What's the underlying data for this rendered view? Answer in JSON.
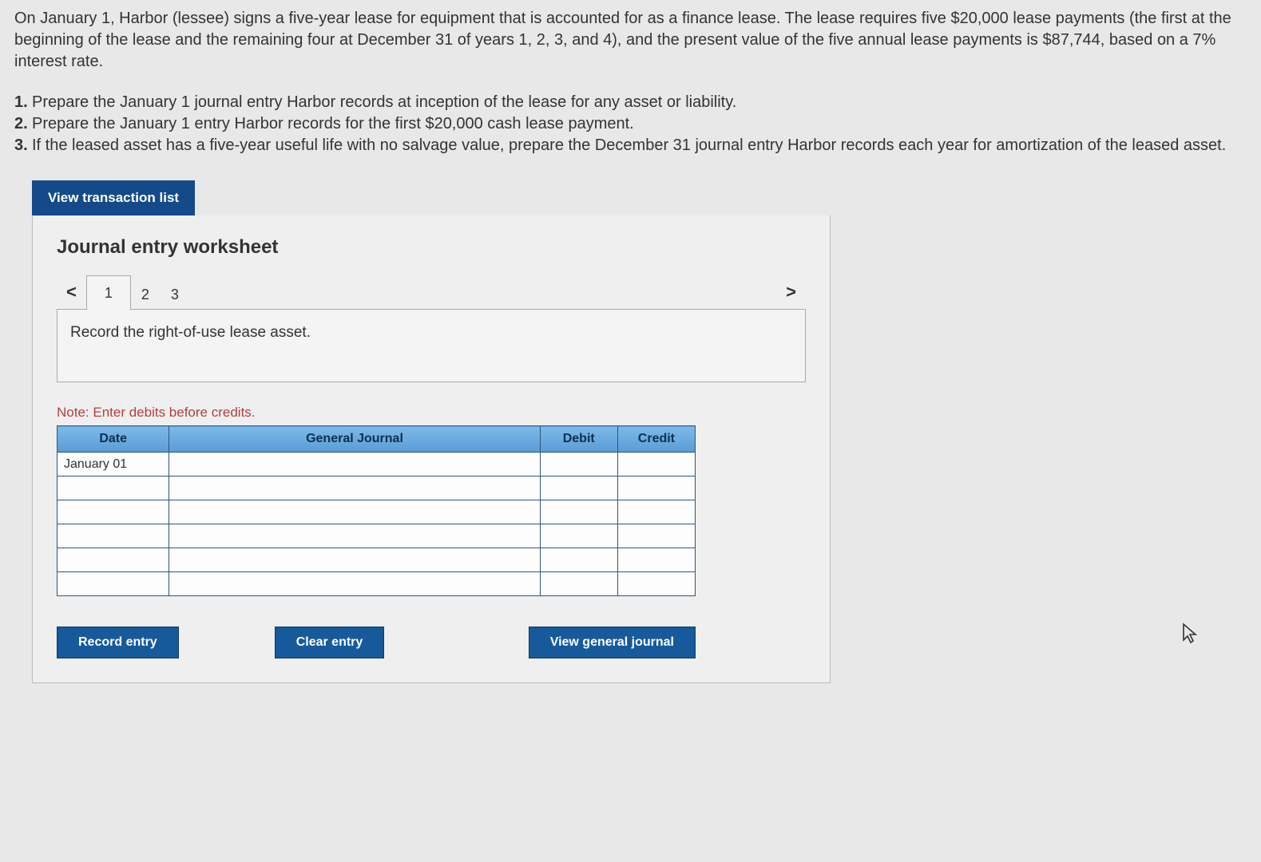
{
  "problem": {
    "p1": "On January 1, Harbor (lessee) signs a five-year lease for equipment that is accounted for as a finance lease. The lease requires five $20,000 lease payments (the first at the beginning of the lease and the remaining four at December 31 of years 1, 2, 3, and 4), and the present value of the five annual lease payments is $87,744, based on a 7% interest rate."
  },
  "questions": {
    "q1num": "1.",
    "q1": "Prepare the January 1 journal entry Harbor records at inception of the lease for any asset or liability.",
    "q2num": "2.",
    "q2": "Prepare the January 1 entry Harbor records for the first $20,000 cash lease payment.",
    "q3num": "3.",
    "q3": "If the leased asset has a five-year useful life with no salvage value, prepare the December 31 journal entry Harbor records each year for amortization of the leased asset."
  },
  "buttons": {
    "view_transaction": "View transaction list",
    "record_entry": "Record entry",
    "clear_entry": "Clear entry",
    "view_general_journal": "View general journal"
  },
  "worksheet": {
    "title": "Journal entry worksheet",
    "prev": "<",
    "next": ">",
    "tabs": [
      "1",
      "2",
      "3"
    ],
    "desc": "Record the right-of-use lease asset.",
    "note": "Note: Enter debits before credits.",
    "headers": {
      "date": "Date",
      "gj": "General Journal",
      "debit": "Debit",
      "credit": "Credit"
    },
    "rows": [
      {
        "date": "January 01",
        "gj": "",
        "debit": "",
        "credit": ""
      },
      {
        "date": "",
        "gj": "",
        "debit": "",
        "credit": ""
      },
      {
        "date": "",
        "gj": "",
        "debit": "",
        "credit": ""
      },
      {
        "date": "",
        "gj": "",
        "debit": "",
        "credit": ""
      },
      {
        "date": "",
        "gj": "",
        "debit": "",
        "credit": ""
      },
      {
        "date": "",
        "gj": "",
        "debit": "",
        "credit": ""
      }
    ]
  }
}
